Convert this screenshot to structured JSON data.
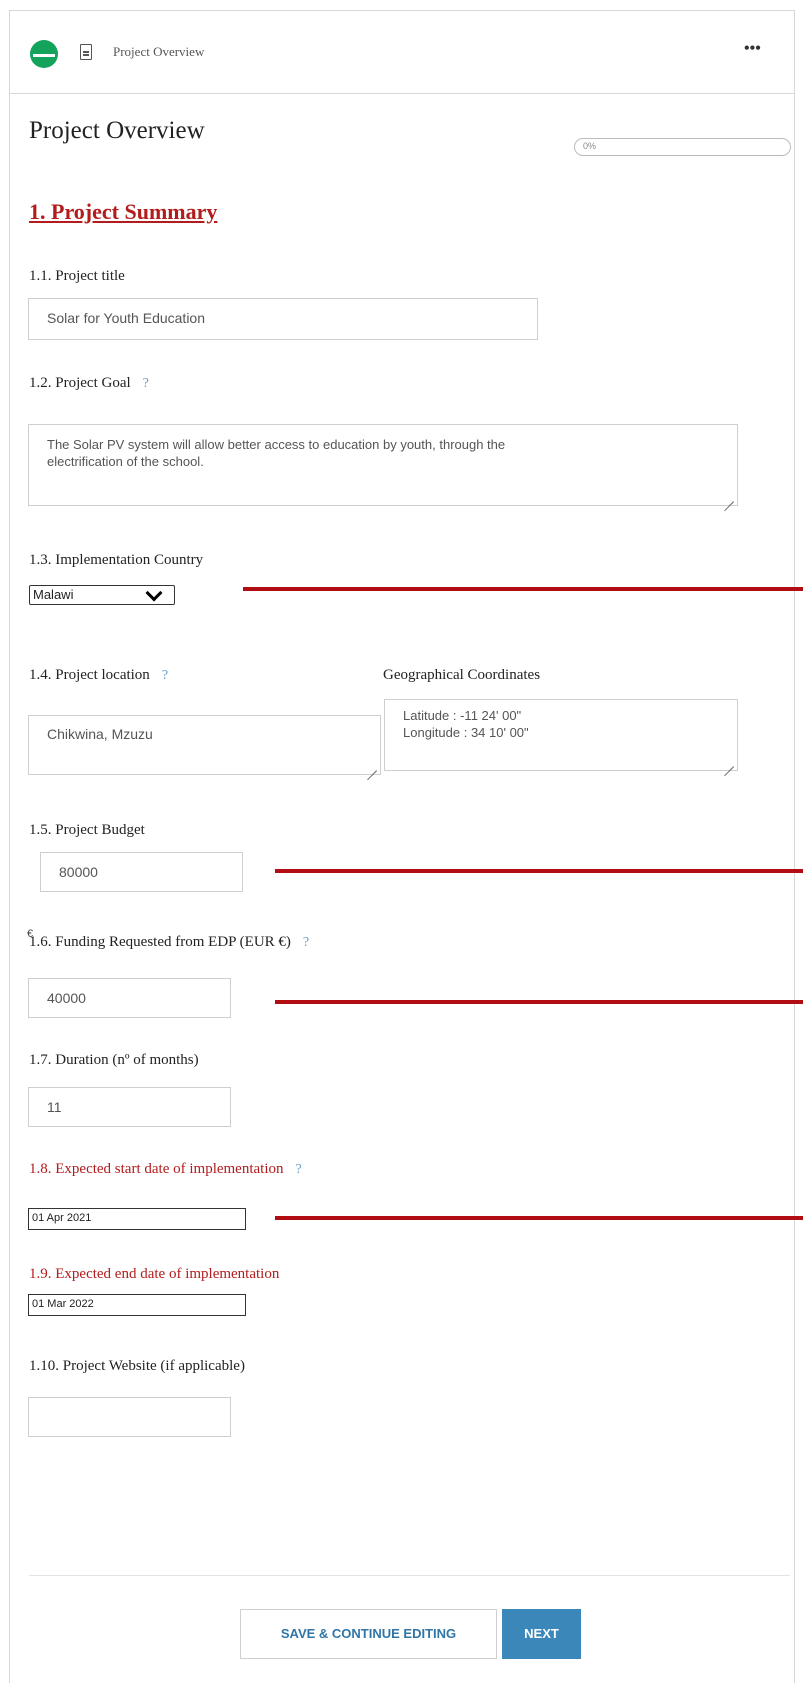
{
  "header": {
    "breadcrumb": "Project Overview",
    "more_icon": "•••"
  },
  "page": {
    "title": "Project Overview",
    "progress_label": "0%",
    "progress_value": 0
  },
  "section": {
    "title": "1. Project Summary"
  },
  "fields": {
    "title": {
      "label": "1.1. Project title",
      "value": "Solar for Youth Education"
    },
    "goal": {
      "label": "1.2. Project Goal",
      "help": "?",
      "value": "The Solar PV system will allow better access to education by youth, through the\nelectrification of the school."
    },
    "country": {
      "label": "1.3. Implementation Country",
      "value": "Malawi"
    },
    "location": {
      "label": "1.4. Project location",
      "help": "?",
      "value": "Chikwina, Mzuzu"
    },
    "coordinates": {
      "label": "Geographical Coordinates",
      "value": "Latitude : -11 24' 00\"\nLongitude : 34 10' 00\""
    },
    "budget": {
      "label": "1.5. Project Budget",
      "currency": "€",
      "value": "80000"
    },
    "funding": {
      "label": "1.6. Funding Requested from EDP (EUR €)",
      "help": "?",
      "value": "40000"
    },
    "duration": {
      "label": "1.7. Duration (nº of months)",
      "value": "11"
    },
    "start_date": {
      "label": "1.8. Expected start date of implementation",
      "help": "?",
      "value": "01 Apr 2021"
    },
    "end_date": {
      "label": "1.9. Expected end date of implementation",
      "value": "01 Mar 2022"
    },
    "website": {
      "label": "1.10. Project Website (if applicable)",
      "value": ""
    }
  },
  "buttons": {
    "save": "SAVE & CONTINUE EDITING",
    "next": "NEXT"
  },
  "colors": {
    "accent_red": "#b21c1c",
    "logo_green": "#13a35a",
    "primary_blue": "#3b87b9"
  }
}
